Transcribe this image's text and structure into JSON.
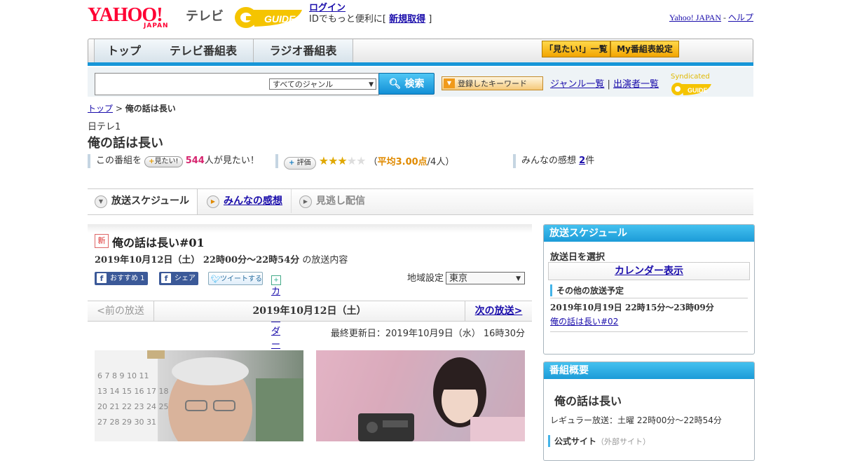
{
  "header": {
    "logo_yahoo": "YAHOO!",
    "logo_japan": "JAPAN",
    "logo_tv": "テレビ",
    "logo_gguide": "G GUIDE",
    "login_link": "ログイン",
    "login_prefix": "IDでもっと便利に[ ",
    "register_link": "新規取得",
    "login_suffix": " ]",
    "yahoo_japan_link": "Yahoo! JAPAN",
    "sep": " - ",
    "help_link": "ヘルプ"
  },
  "nav": {
    "tabs": [
      "トップ",
      "テレビ番組表",
      "ラジオ番組表"
    ],
    "mitai_list": "「見たい!」一覧",
    "my_schedule": "My番組表設定"
  },
  "search": {
    "genre_selected": "すべてのジャンル",
    "search_button": "検索",
    "keyword_button": "登録したキーワード",
    "genre_list": "ジャンル一覧",
    "divider": "|",
    "performer_list": "出演者一覧",
    "syndicated": "Syndicated"
  },
  "breadcrumb": {
    "top": "トップ",
    "sep": " > ",
    "current": "俺の話は長い"
  },
  "program": {
    "station": "日テレ1",
    "title": "俺の話は長い",
    "stats": {
      "prefix": "この番組を",
      "mitai_button": "見たい!",
      "mitai_count": "544",
      "mitai_suffix": "人が見たい！",
      "hyoka_button": "評価",
      "rating_value": 3,
      "rating_open": "（",
      "rating_avg": "平均3.00点",
      "rating_people": "/4人）",
      "kanso_label": "みんなの感想 ",
      "kanso_count": "2",
      "kanso_suffix": "件"
    }
  },
  "tabs": {
    "schedule": "放送スケジュール",
    "reviews": "みんなの感想",
    "missed": "見逃し配信"
  },
  "episode": {
    "new_badge": "新",
    "title": "俺の話は長い#01",
    "date": "2019年10月12日（土） 22時00分～22時54分",
    "date_suffix": " の放送内容",
    "fb_recommend": "おすすめ 1",
    "fb_share": "シェア",
    "tweet": "ツイートする",
    "calendar_add": "カレンダーに登録",
    "region_label": "地域設定",
    "region_selected": "東京",
    "prev": "<前の放送",
    "current_date": "2019年10月12日（土）",
    "next": "次の放送>",
    "updated": "最終更新日：2019年10月9日（水） 16時30分"
  },
  "sidebar": {
    "schedule_header": "放送スケジュール",
    "select_date": "放送日を選択",
    "calendar_view": "カレンダー表示",
    "other_schedule": "その他の放送予定",
    "next_date": "2019年10月19日 22時15分～23時09分",
    "next_link": "俺の話は長い#02",
    "overview_header": "番組概要",
    "overview_title": "俺の話は長い",
    "regular": "レギュラー放送：土曜 22時00分～22時54分",
    "official_site": "公式サイト",
    "official_note": "（外部サイト）"
  },
  "colors": {
    "accent_blue": "#1696d8",
    "brand_red": "#ff0033",
    "gguide_yellow": "#f5c400"
  }
}
